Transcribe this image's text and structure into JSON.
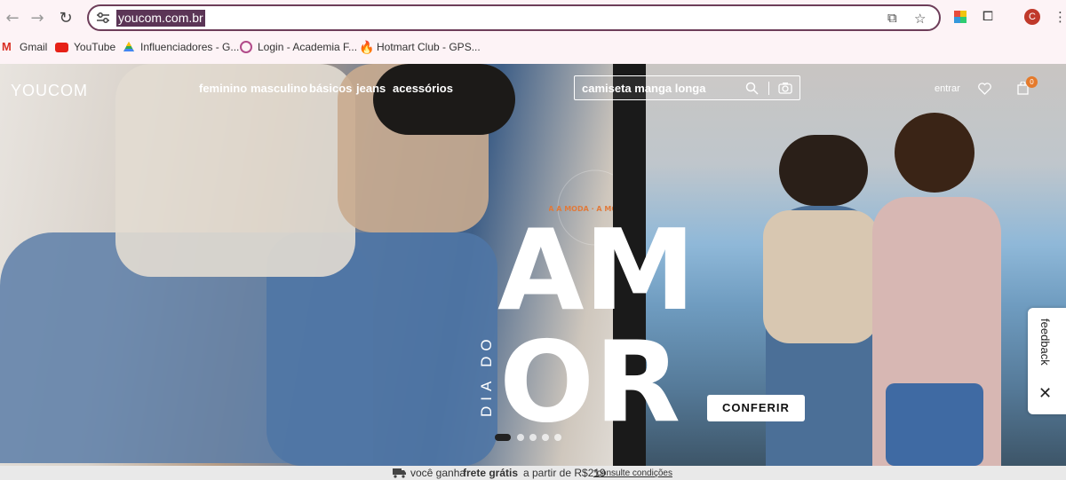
{
  "browser": {
    "url": "youcom.com.br",
    "bookmarks": [
      {
        "label": "Gmail"
      },
      {
        "label": "YouTube"
      },
      {
        "label": "Influenciadores - G..."
      },
      {
        "label": "Login - Academia F..."
      },
      {
        "label": "Hotmart Club - GPS..."
      }
    ]
  },
  "site": {
    "logo": "YOUCOM",
    "nav": [
      "feminino",
      "masculino",
      "básicos",
      "jeans",
      "acessórios"
    ],
    "search_value": "camiseta manga longa",
    "login_label": "entrar",
    "cart_count": "0"
  },
  "hero": {
    "headline_line1": "AM",
    "headline_line2": "OR",
    "vertical_text": "DIA DO",
    "badge_text": "VC TRANSFORMA A MODA · A MODA TRANSFORMA VC ·",
    "cta_label": "CONFERIR",
    "slide_count": 5,
    "active_slide": 1
  },
  "feedback": {
    "label": "feedback"
  },
  "shipping_bar": {
    "prefix": "você ganha",
    "bold": "frete grátis",
    "suffix": "a partir de R$219",
    "link": "*consulte condições"
  },
  "colors": {
    "omnibox_border": "#6d3d59",
    "url_highlight": "#5b3556",
    "cart_badge": "#e57a2b"
  }
}
